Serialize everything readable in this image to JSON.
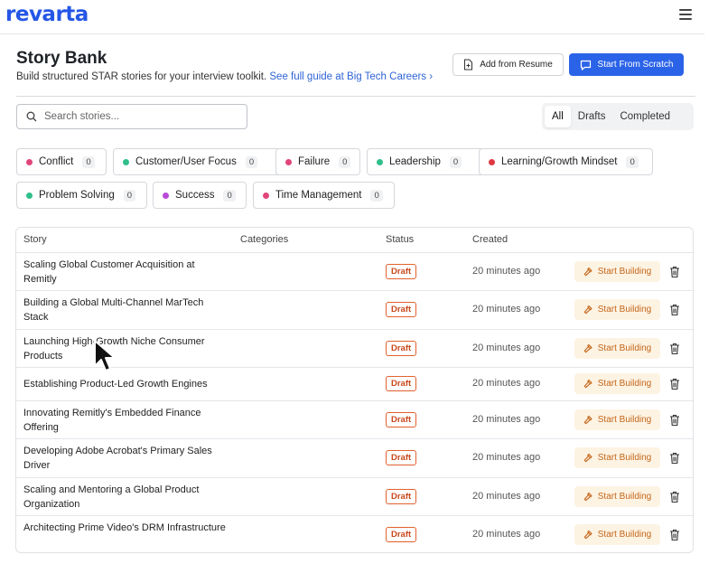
{
  "brand": {
    "logo_text": "revarta",
    "color": "#2456e6"
  },
  "header": {
    "title": "Story Bank",
    "subtitle": "Build structured STAR stories for your interview toolkit.",
    "guide_link": "See full guide at Big Tech Careers ›",
    "add_from_resume": "Add from Resume",
    "start_from_scratch": "Start From Scratch"
  },
  "search": {
    "placeholder": "Search stories..."
  },
  "filters": {
    "tabs": [
      "All",
      "Drafts",
      "Completed"
    ],
    "active": "All"
  },
  "categories": [
    {
      "label": "Conflict",
      "count": "0",
      "color": "#e0457b"
    },
    {
      "label": "Customer/User Focus",
      "count": "0",
      "color": "#2fbf8a"
    },
    {
      "label": "Failure",
      "count": "0",
      "color": "#e0457b"
    },
    {
      "label": "Leadership",
      "count": "0",
      "color": "#2fbf8a"
    },
    {
      "label": "Learning/Growth Mindset",
      "count": "0",
      "color": "#e0373f"
    },
    {
      "label": "Problem Solving",
      "count": "0",
      "color": "#2fbf8a"
    },
    {
      "label": "Success",
      "count": "0",
      "color": "#b84ad9"
    },
    {
      "label": "Time Management",
      "count": "0",
      "color": "#e0457b"
    }
  ],
  "table": {
    "columns": [
      "Story",
      "Categories",
      "Status",
      "Created"
    ],
    "action_label": "Start Building",
    "rows": [
      {
        "story": "Scaling Global Customer Acquisition at Remitly",
        "status": "Draft",
        "created": "20 minutes ago"
      },
      {
        "story": "Building a Global Multi-Channel MarTech Stack",
        "status": "Draft",
        "created": "20 minutes ago"
      },
      {
        "story": "Launching High-Growth Niche Consumer Products",
        "status": "Draft",
        "created": "20 minutes ago"
      },
      {
        "story": "Establishing Product-Led Growth Engines",
        "status": "Draft",
        "created": "20 minutes ago"
      },
      {
        "story": "Innovating Remitly's Embedded Finance Offering",
        "status": "Draft",
        "created": "20 minutes ago"
      },
      {
        "story": "Developing Adobe Acrobat's Primary Sales Driver",
        "status": "Draft",
        "created": "20 minutes ago"
      },
      {
        "story": "Scaling and Mentoring a Global Product Organization",
        "status": "Draft",
        "created": "20 minutes ago"
      },
      {
        "story": "Architecting Prime Video's DRM Infrastructure",
        "status": "Draft",
        "created": "20 minutes ago"
      }
    ]
  }
}
